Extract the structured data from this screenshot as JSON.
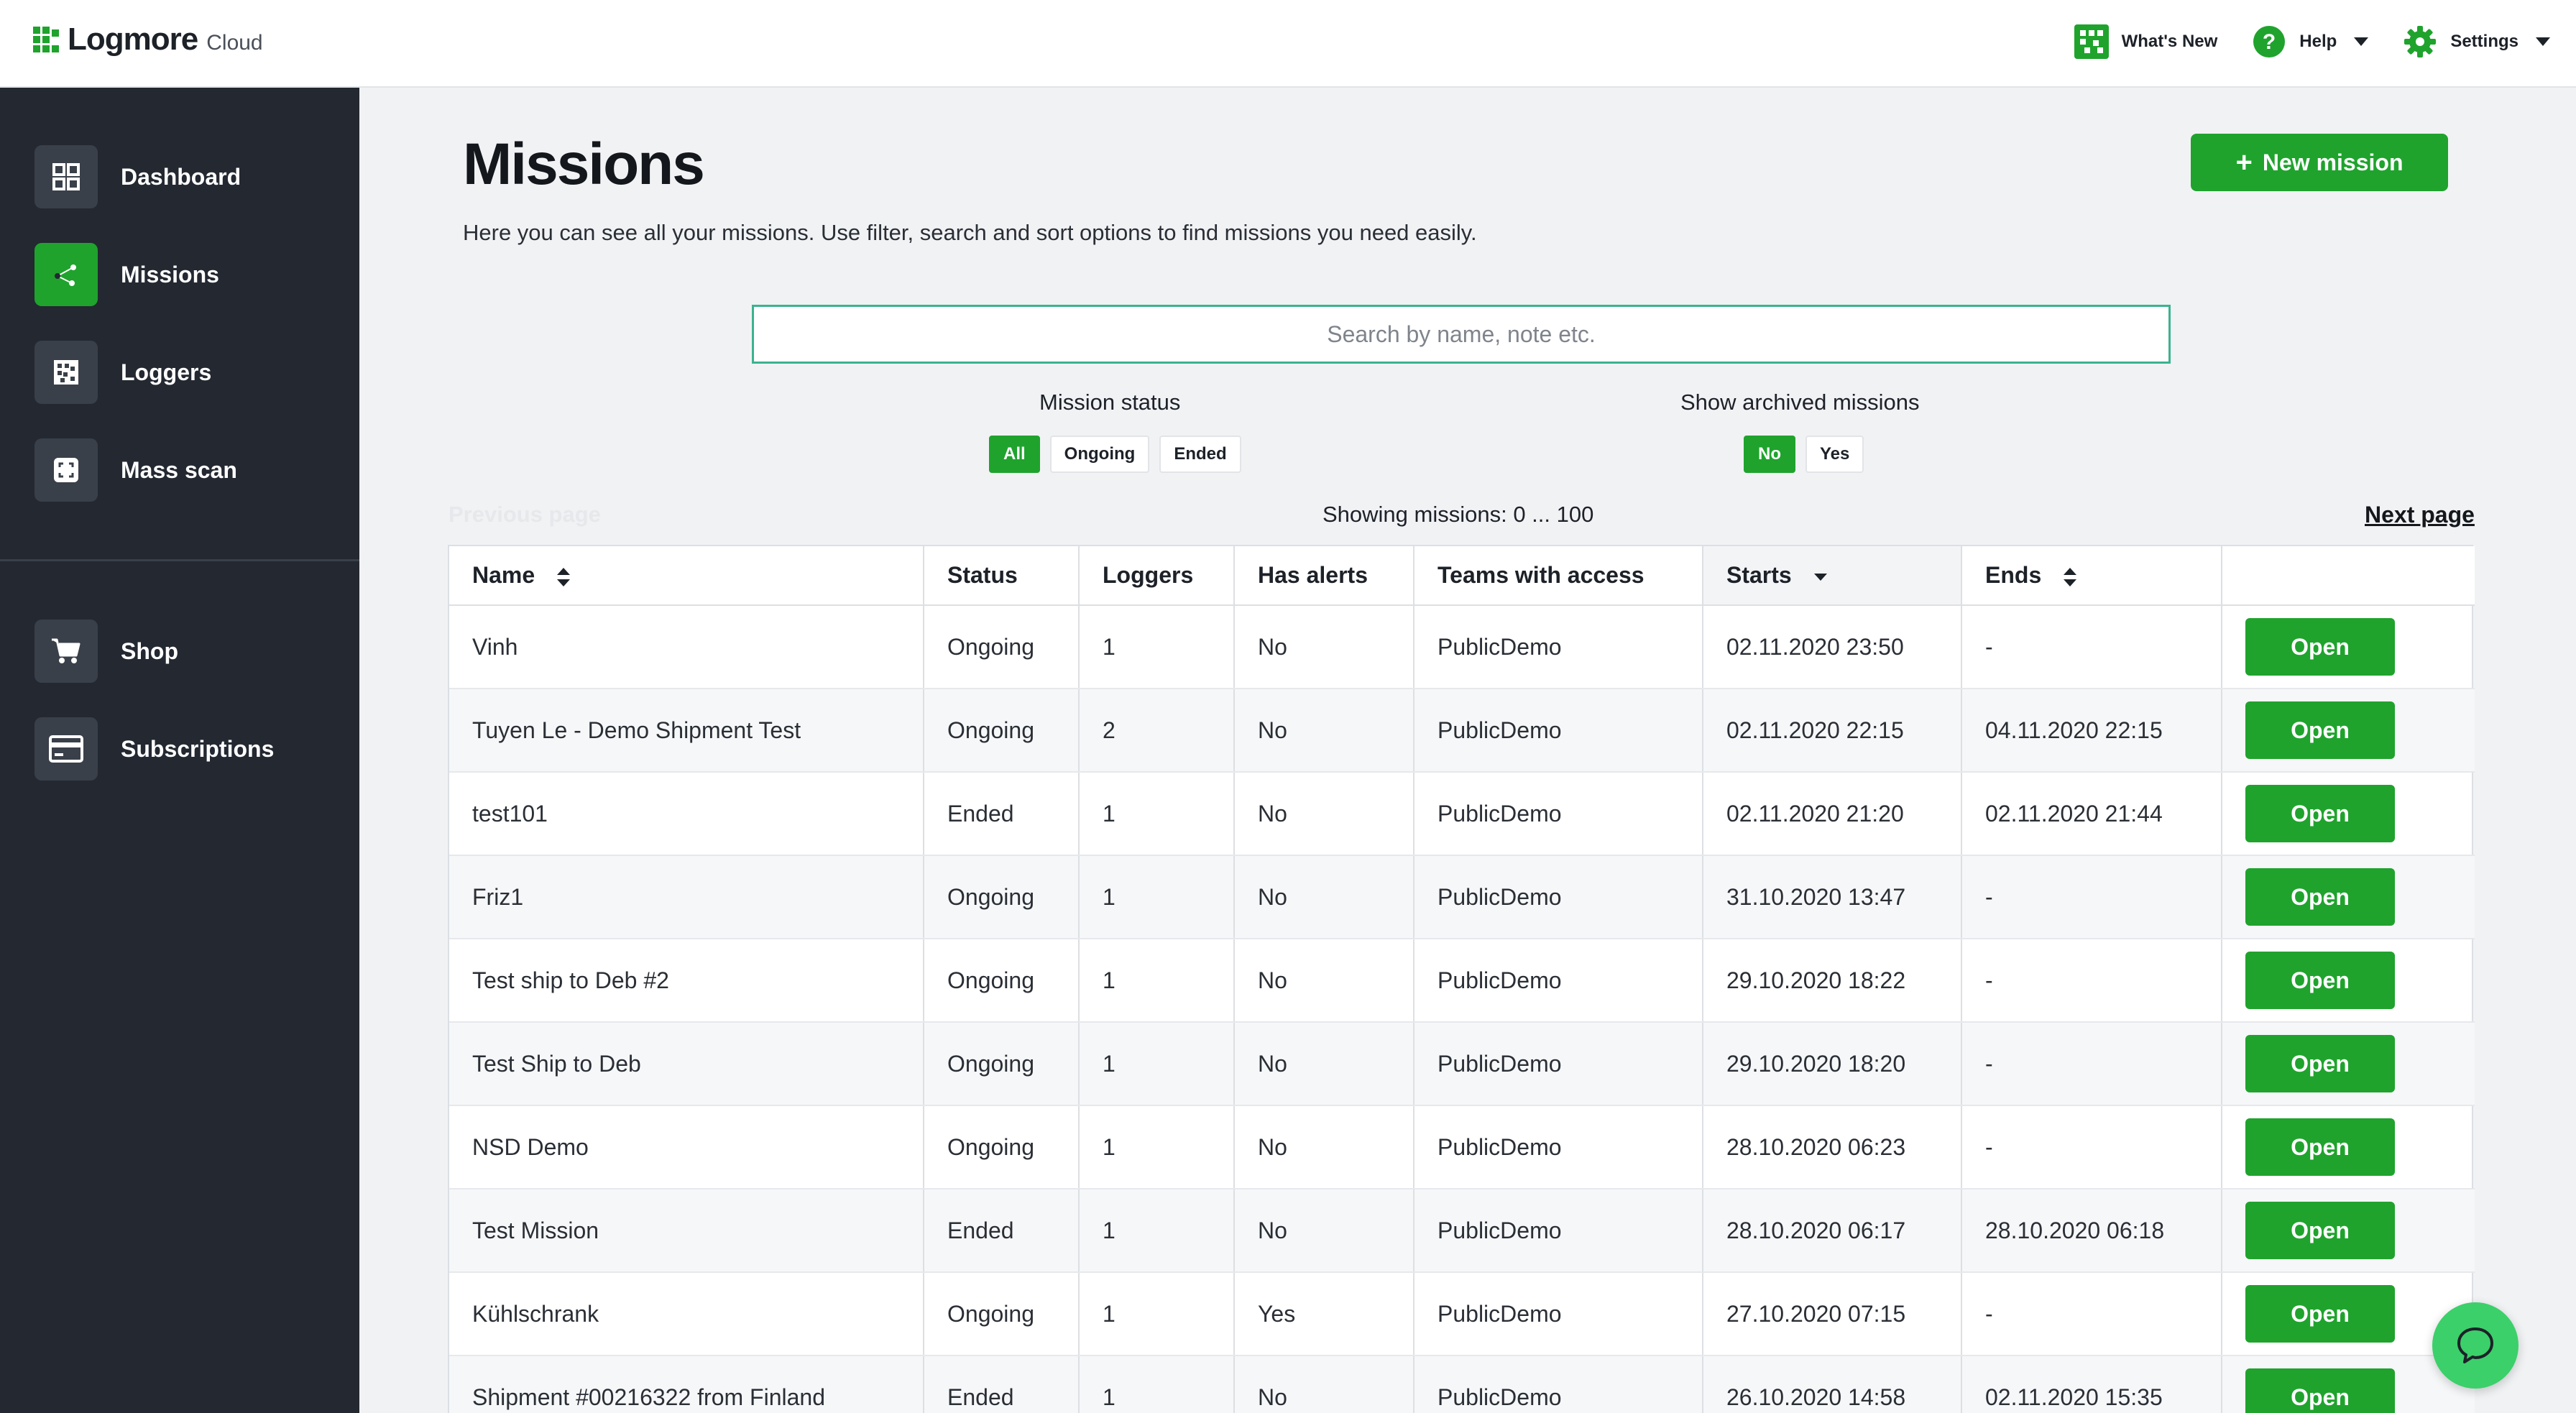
{
  "header": {
    "brand_name": "Logmore",
    "brand_sub": "Cloud",
    "whats_new": "What's New",
    "help": "Help",
    "settings": "Settings"
  },
  "sidebar": {
    "items": [
      {
        "label": "Dashboard",
        "icon": "dashboard-icon"
      },
      {
        "label": "Missions",
        "icon": "missions-icon",
        "active": true
      },
      {
        "label": "Loggers",
        "icon": "loggers-icon"
      },
      {
        "label": "Mass scan",
        "icon": "mass-scan-icon"
      },
      {
        "label": "Shop",
        "icon": "cart-icon"
      },
      {
        "label": "Subscriptions",
        "icon": "credit-card-icon"
      }
    ]
  },
  "main": {
    "title": "Missions",
    "description": "Here you can see all your missions. Use filter, search and sort options to find missions you need easily.",
    "new_mission_label": "New mission",
    "search_placeholder": "Search by name, note etc.",
    "mission_status": {
      "label": "Mission status",
      "options": [
        "All",
        "Ongoing",
        "Ended"
      ],
      "selected": "All"
    },
    "show_archived": {
      "label": "Show archived missions",
      "options": [
        "No",
        "Yes"
      ],
      "selected": "No"
    },
    "previous_page": "Previous page",
    "showing": "Showing missions: 0 ... 100",
    "next_page": "Next page"
  },
  "table": {
    "columns": [
      "Name",
      "Status",
      "Loggers",
      "Has alerts",
      "Teams with access",
      "Starts",
      "Ends",
      ""
    ],
    "open_label": "Open",
    "rows": [
      {
        "name": "Vinh",
        "status": "Ongoing",
        "loggers": "1",
        "alerts": "No",
        "teams": "PublicDemo",
        "starts": "02.11.2020 23:50",
        "ends": "-"
      },
      {
        "name": "Tuyen Le - Demo Shipment Test",
        "status": "Ongoing",
        "loggers": "2",
        "alerts": "No",
        "teams": "PublicDemo",
        "starts": "02.11.2020 22:15",
        "ends": "04.11.2020 22:15"
      },
      {
        "name": "test101",
        "status": "Ended",
        "loggers": "1",
        "alerts": "No",
        "teams": "PublicDemo",
        "starts": "02.11.2020 21:20",
        "ends": "02.11.2020 21:44"
      },
      {
        "name": "Friz1",
        "status": "Ongoing",
        "loggers": "1",
        "alerts": "No",
        "teams": "PublicDemo",
        "starts": "31.10.2020 13:47",
        "ends": "-"
      },
      {
        "name": "Test ship to Deb #2",
        "status": "Ongoing",
        "loggers": "1",
        "alerts": "No",
        "teams": "PublicDemo",
        "starts": "29.10.2020 18:22",
        "ends": "-"
      },
      {
        "name": "Test Ship to Deb",
        "status": "Ongoing",
        "loggers": "1",
        "alerts": "No",
        "teams": "PublicDemo",
        "starts": "29.10.2020 18:20",
        "ends": "-"
      },
      {
        "name": "NSD Demo",
        "status": "Ongoing",
        "loggers": "1",
        "alerts": "No",
        "teams": "PublicDemo",
        "starts": "28.10.2020 06:23",
        "ends": "-"
      },
      {
        "name": "Test Mission",
        "status": "Ended",
        "loggers": "1",
        "alerts": "No",
        "teams": "PublicDemo",
        "starts": "28.10.2020 06:17",
        "ends": "28.10.2020 06:18"
      },
      {
        "name": "Kühlschrank",
        "status": "Ongoing",
        "loggers": "1",
        "alerts": "Yes",
        "teams": "PublicDemo",
        "starts": "27.10.2020 07:15",
        "ends": "-"
      },
      {
        "name": "Shipment #00216322 from Finland",
        "status": "Ended",
        "loggers": "1",
        "alerts": "No",
        "teams": "PublicDemo",
        "starts": "26.10.2020 14:58",
        "ends": "02.11.2020 15:35"
      }
    ]
  },
  "colors": {
    "accent": "#1fa32d",
    "sidebar_bg": "#232831",
    "page_bg": "#f1f2f4",
    "chat_bubble": "#3bd06a"
  }
}
